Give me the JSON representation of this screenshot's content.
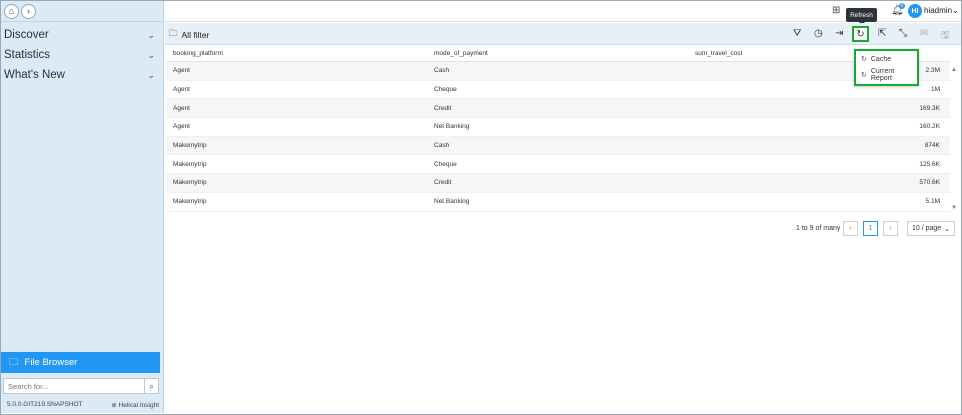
{
  "sidebar": {
    "menu": [
      {
        "label": "Discover"
      },
      {
        "label": "Statistics"
      },
      {
        "label": "What's New"
      }
    ],
    "file_browser_label": "File Browser",
    "search_placeholder": "Search for...",
    "version": "5.0.0.GIT219.SNAPSHOT",
    "brand": "Helical Insight"
  },
  "header": {
    "username": "hiadmin",
    "avatar_initials": "HI",
    "notification_count": "0",
    "tooltip": "Refresh"
  },
  "toolbar": {
    "filter_label": "All filter"
  },
  "table": {
    "columns": [
      "booking_platform",
      "mode_of_payment",
      "sum_travel_cost"
    ],
    "rows": [
      [
        "Agent",
        "Cash",
        "2.3M"
      ],
      [
        "Agent",
        "Cheque",
        "1M"
      ],
      [
        "Agent",
        "Credit",
        "169.3K"
      ],
      [
        "Agent",
        "Net Banking",
        "160.2K"
      ],
      [
        "Makemytrip",
        "Cash",
        "874K"
      ],
      [
        "Makemytrip",
        "Cheque",
        "125.6K"
      ],
      [
        "Makemytrip",
        "Credit",
        "570.6K"
      ],
      [
        "Makemytrip",
        "Net Banking",
        "5.1M"
      ]
    ]
  },
  "refresh_menu": {
    "items": [
      {
        "label": "Cache"
      },
      {
        "label": "Current Report"
      }
    ]
  },
  "pagination": {
    "summary": "1 to 9 of many",
    "current_page": "1",
    "page_size": "10 / page"
  },
  "colors": {
    "accent": "#2196f3",
    "highlight": "#19a834",
    "sidebar_bg": "#dbeaf5"
  }
}
